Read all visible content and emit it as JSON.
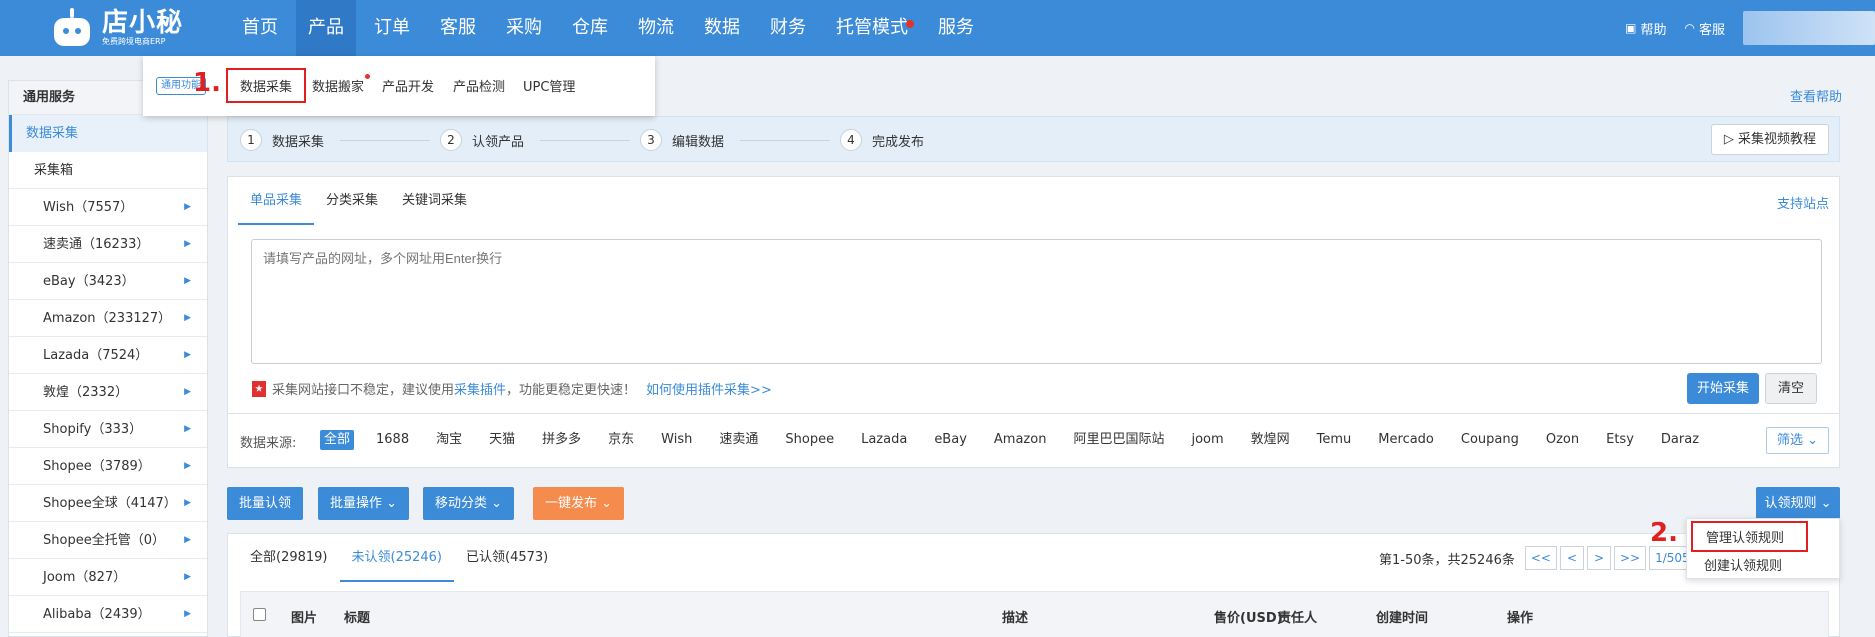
{
  "brand": {
    "name": "店小秘",
    "tagline": "免费跨境电商ERP"
  },
  "nav": {
    "items": [
      "首页",
      "产品",
      "订单",
      "客服",
      "采购",
      "仓库",
      "物流",
      "数据",
      "财务",
      "托管模式",
      "服务"
    ],
    "active": "产品"
  },
  "top_right": {
    "help": "帮助",
    "service": "客服"
  },
  "submenu": {
    "service_tag": "通用功能",
    "marker": "1.",
    "items": [
      "数据采集",
      "数据搬家",
      "产品开发",
      "产品检测",
      "UPC管理"
    ]
  },
  "sidebar": {
    "header": "通用服务",
    "active": "数据采集",
    "box": "采集箱",
    "items": [
      {
        "label": "Wish（7557）"
      },
      {
        "label": "速卖通（16233）"
      },
      {
        "label": "eBay（3423）"
      },
      {
        "label": "Amazon（233127）"
      },
      {
        "label": "Lazada（7524）"
      },
      {
        "label": "敦煌（2332）"
      },
      {
        "label": "Shopify（333）"
      },
      {
        "label": "Shopee（3789）"
      },
      {
        "label": "Shopee全球（4147）"
      },
      {
        "label": "Shopee全托管（0）"
      },
      {
        "label": "Joom（827）"
      },
      {
        "label": "Alibaba（2439）"
      }
    ]
  },
  "help_link": "查看帮助",
  "steps": {
    "items": [
      {
        "num": "1",
        "label": "数据采集"
      },
      {
        "num": "2",
        "label": "认领产品"
      },
      {
        "num": "3",
        "label": "编辑数据"
      },
      {
        "num": "4",
        "label": "完成发布"
      }
    ],
    "video_button": "采集视频教程"
  },
  "collect": {
    "tabs": [
      "单品采集",
      "分类采集",
      "关键词采集"
    ],
    "support": "支持站点",
    "placeholder": "请填写产品的网址，多个网址用Enter换行",
    "tip_prefix": "采集网站接口不稳定，建议使用",
    "tip_plugin": "采集插件",
    "tip_suffix": "，功能更稳定更快速！",
    "tip_link": "如何使用插件采集>>",
    "start": "开始采集",
    "clear": "清空"
  },
  "sources": {
    "label": "数据来源:",
    "items": [
      "全部",
      "1688",
      "淘宝",
      "天猫",
      "拼多多",
      "京东",
      "Wish",
      "速卖通",
      "Shopee",
      "Lazada",
      "eBay",
      "Amazon",
      "阿里巴巴国际站",
      "joom",
      "敦煌网",
      "Temu",
      "Mercado",
      "Coupang",
      "Ozon",
      "Etsy",
      "Daraz"
    ],
    "filter": "筛选"
  },
  "actions": {
    "batch_claim": "批量认领",
    "batch_ops": "批量操作",
    "move_category": "移动分类",
    "publish": "一键发布",
    "claim_rules": "认领规则"
  },
  "rule_menu": {
    "marker": "2.",
    "manage": "管理认领规则",
    "create": "创建认领规则"
  },
  "list": {
    "tabs": [
      "全部(29819)",
      "未认领(25246)",
      "已认领(4573)"
    ],
    "pager_info": "第1-50条，共25246条",
    "pager_buttons": [
      "<<",
      "<",
      ">",
      ">>"
    ],
    "page": "1/505",
    "columns": [
      "图片",
      "标题",
      "描述",
      "售价(USD)",
      "责任人",
      "创建时间",
      "操作"
    ]
  }
}
